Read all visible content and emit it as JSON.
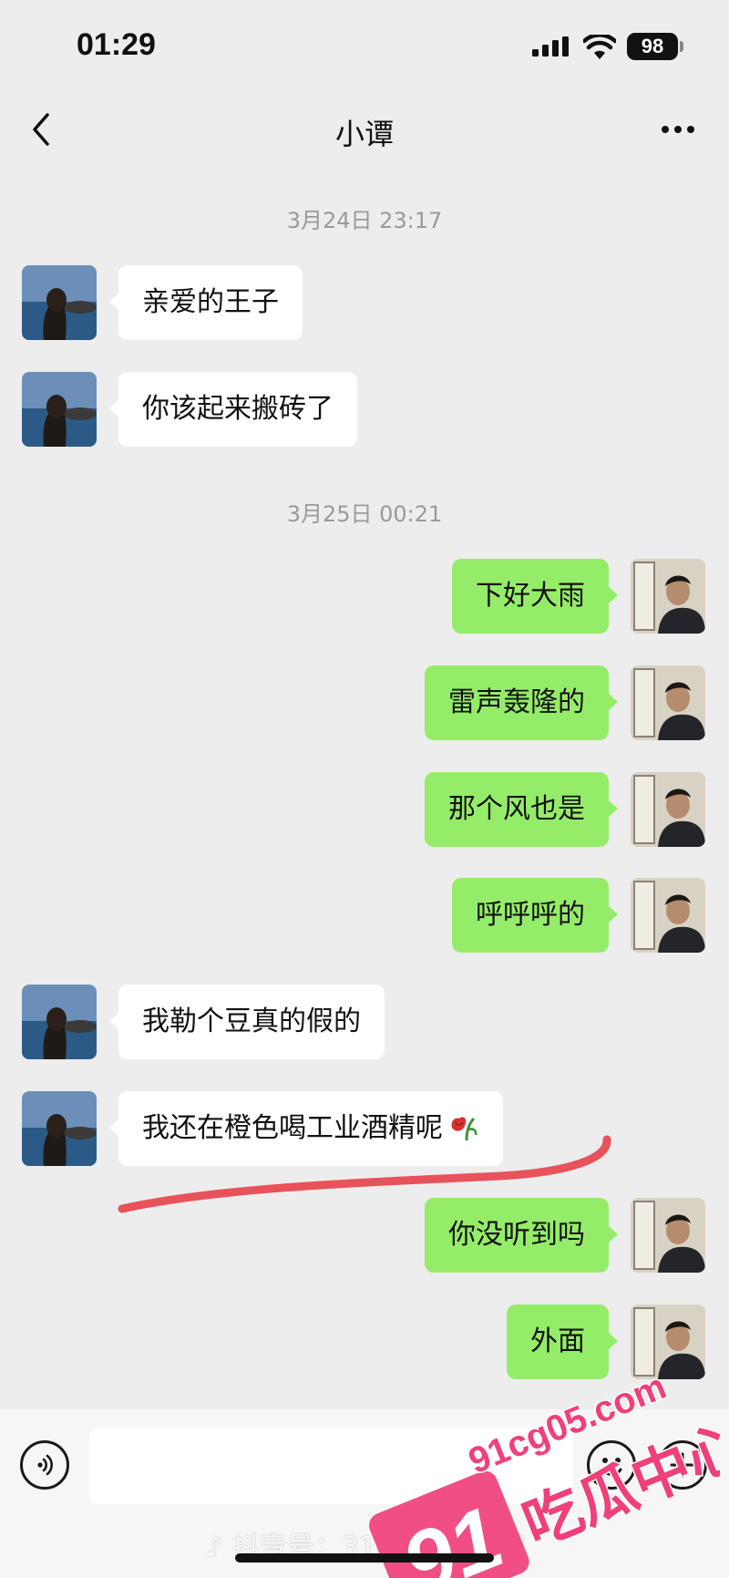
{
  "status_bar": {
    "time": "01:29",
    "battery": "98"
  },
  "nav": {
    "title": "小谭"
  },
  "messages": [
    {
      "type": "time",
      "text": "3月24日 23:17"
    },
    {
      "type": "msg",
      "side": "left",
      "text": "亲爱的王子"
    },
    {
      "type": "msg",
      "side": "left",
      "text": "你该起来搬砖了"
    },
    {
      "type": "time",
      "text": "3月25日 00:21"
    },
    {
      "type": "msg",
      "side": "right",
      "text": "下好大雨"
    },
    {
      "type": "msg",
      "side": "right",
      "text": "雷声轰隆的"
    },
    {
      "type": "msg",
      "side": "right",
      "text": "那个风也是"
    },
    {
      "type": "msg",
      "side": "right",
      "text": "呼呼呼的"
    },
    {
      "type": "msg",
      "side": "left",
      "text": "我勒个豆真的假的"
    },
    {
      "type": "msg",
      "side": "left",
      "text": "我还在橙色喝工业酒精呢",
      "emoji": "wilted-rose"
    },
    {
      "type": "msg",
      "side": "right",
      "text": "你没听到吗"
    },
    {
      "type": "msg",
      "side": "right",
      "text": "外面"
    }
  ],
  "input": {
    "value": ""
  },
  "watermarks": {
    "douyin": "抖音号：318•••••787",
    "logo_number": "91",
    "logo_text": "吃瓜中心",
    "logo_url": "91cg05.com"
  },
  "colors": {
    "background": "#ededed",
    "own_bubble": "#95ec69",
    "other_bubble": "#ffffff",
    "scribble": "#e8525a",
    "logo_pink": "#f0407a"
  }
}
